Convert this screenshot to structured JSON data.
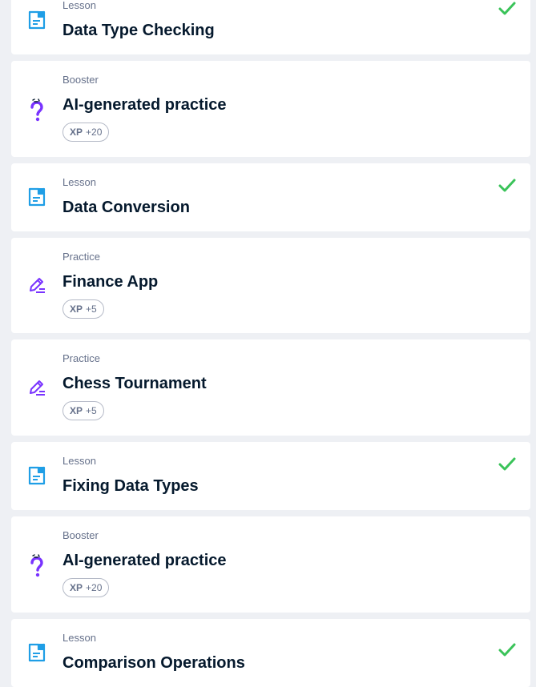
{
  "items": [
    {
      "type": "Lesson",
      "title": "Data Type Checking",
      "icon": "lesson-document-icon",
      "completed": true
    },
    {
      "type": "Booster",
      "title": "AI-generated practice",
      "icon": "question-mark-icon",
      "completed": false,
      "xp_label": "XP",
      "xp_points": "+20"
    },
    {
      "type": "Lesson",
      "title": "Data Conversion",
      "icon": "lesson-document-icon",
      "completed": true
    },
    {
      "type": "Practice",
      "title": "Finance App",
      "icon": "pencil-icon",
      "completed": false,
      "xp_label": "XP",
      "xp_points": "+5"
    },
    {
      "type": "Practice",
      "title": "Chess Tournament",
      "icon": "pencil-icon",
      "completed": false,
      "xp_label": "XP",
      "xp_points": "+5"
    },
    {
      "type": "Lesson",
      "title": "Fixing Data Types",
      "icon": "lesson-document-icon",
      "completed": true
    },
    {
      "type": "Booster",
      "title": "AI-generated practice",
      "icon": "question-mark-icon",
      "completed": false,
      "xp_label": "XP",
      "xp_points": "+20"
    },
    {
      "type": "Lesson",
      "title": "Comparison Operations",
      "icon": "lesson-document-icon",
      "completed": true
    }
  ],
  "colors": {
    "lesson_icon": "#1f9ee6",
    "practice_icon": "#7933ff",
    "check": "#3ac359",
    "text_primary": "#05192d",
    "text_secondary": "#65708a"
  }
}
